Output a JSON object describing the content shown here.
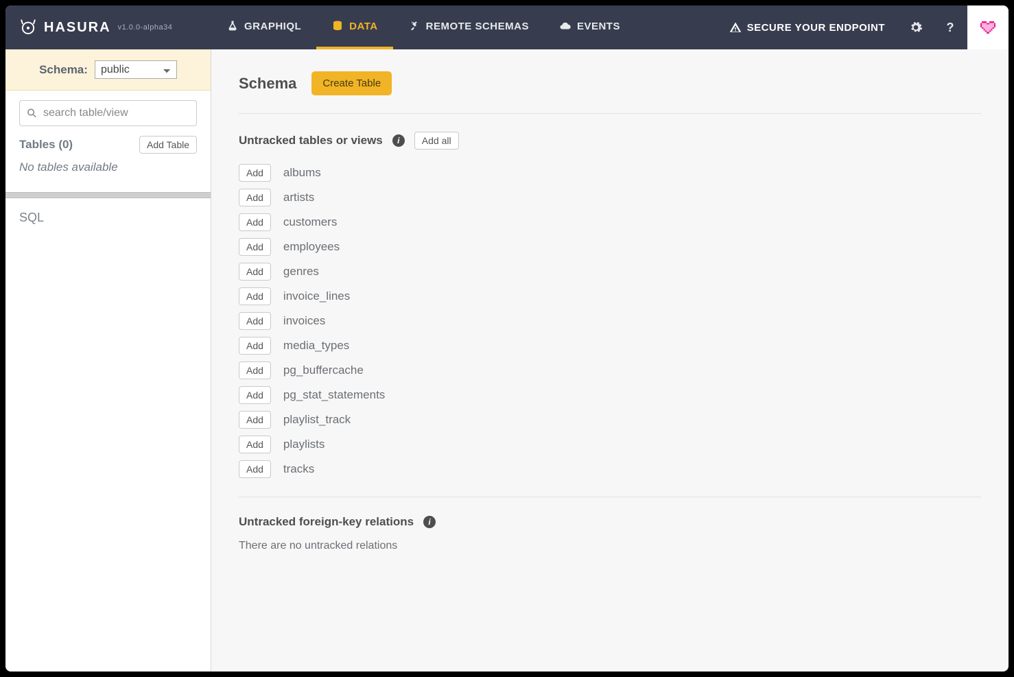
{
  "brand": {
    "name": "HASURA",
    "version": "v1.0.0-alpha34"
  },
  "nav": {
    "tabs": [
      {
        "label": "GRAPHIQL",
        "active": false
      },
      {
        "label": "DATA",
        "active": true
      },
      {
        "label": "REMOTE SCHEMAS",
        "active": false
      },
      {
        "label": "EVENTS",
        "active": false
      }
    ],
    "secure": "SECURE YOUR ENDPOINT",
    "help": "?"
  },
  "sidebar": {
    "schema_label": "Schema:",
    "schema_value": "public",
    "search_placeholder": "search table/view",
    "tables_title": "Tables (0)",
    "add_table": "Add Table",
    "no_tables": "No tables available",
    "sql": "SQL"
  },
  "main": {
    "title": "Schema",
    "create_table": "Create Table",
    "untracked_title": "Untracked tables or views",
    "add_all": "Add all",
    "add": "Add",
    "untracked": [
      "albums",
      "artists",
      "customers",
      "employees",
      "genres",
      "invoice_lines",
      "invoices",
      "media_types",
      "pg_buffercache",
      "pg_stat_statements",
      "playlist_track",
      "playlists",
      "tracks"
    ],
    "fk_title": "Untracked foreign-key relations",
    "fk_empty": "There are no untracked relations"
  }
}
